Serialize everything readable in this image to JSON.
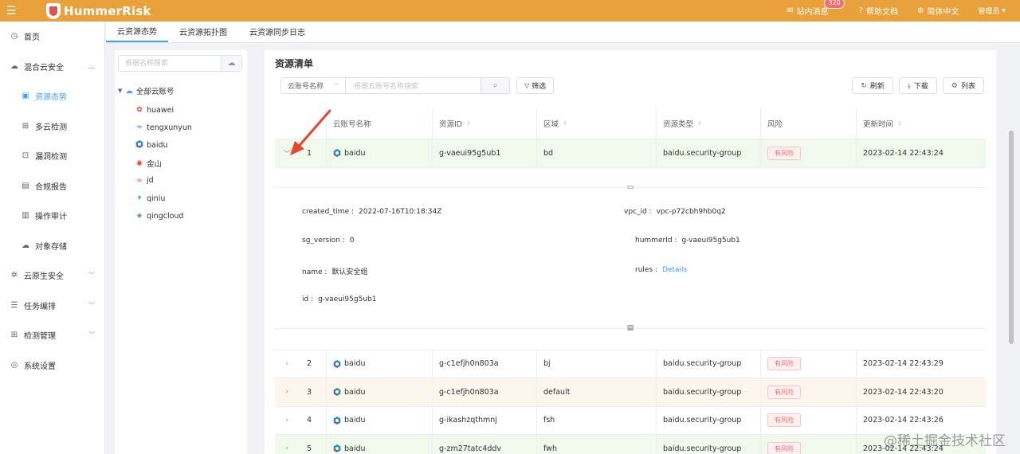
{
  "header": {
    "app_name": "HummerRisk",
    "messages_label": "站内消息",
    "messages_badge": "320",
    "help_label": "帮助文档",
    "language_label": "简体中文",
    "user_label": "管理员"
  },
  "sidebar": {
    "items": [
      {
        "label": "首页",
        "icon": "clock-icon"
      },
      {
        "label": "混合云安全",
        "icon": "cloud-icon"
      },
      {
        "label": "资源态势",
        "icon": "chart-icon"
      },
      {
        "label": "多云检测",
        "icon": "grid-icon"
      },
      {
        "label": "漏洞检测",
        "icon": "bug-icon"
      },
      {
        "label": "合规报告",
        "icon": "report-icon"
      },
      {
        "label": "操作审计",
        "icon": "audit-icon"
      },
      {
        "label": "对象存储",
        "icon": "storage-icon"
      },
      {
        "label": "云原生安全",
        "icon": "gear-icon"
      },
      {
        "label": "任务编排",
        "icon": "list-icon"
      },
      {
        "label": "检测管理",
        "icon": "manage-icon"
      },
      {
        "label": "系统设置",
        "icon": "settings-icon"
      }
    ]
  },
  "tabs": [
    "云资源态势",
    "云资源拓扑图",
    "云资源同步日志"
  ],
  "tree": {
    "search_placeholder": "根据名称搜索",
    "root_label": "全部云账号",
    "nodes": [
      "huawei",
      "tengxunyun",
      "baidu",
      "金山",
      "jd",
      "qiniu",
      "qingcloud"
    ]
  },
  "main": {
    "title": "资源清单",
    "select_label": "云账号名称",
    "search_placeholder": "根据云账号名称搜索",
    "filter_label": "筛选",
    "refresh_label": "刷新",
    "download_label": "下载",
    "columns_label": "列表",
    "headers": [
      "云账号名称",
      "资源ID",
      "区域",
      "资源类型",
      "风险",
      "更新时间"
    ],
    "rows": [
      {
        "idx": "1",
        "account": "baidu",
        "id": "g-vaeui95g5ub1",
        "region": "bd",
        "type": "baidu.security-group",
        "risk": "有风险",
        "time": "2023-02-14 22:43:24"
      },
      {
        "idx": "2",
        "account": "baidu",
        "id": "g-c1efjh0n803a",
        "region": "bj",
        "type": "baidu.security-group",
        "risk": "有风险",
        "time": "2023-02-14 22:43:29"
      },
      {
        "idx": "3",
        "account": "baidu",
        "id": "g-c1efjh0n803a",
        "region": "default",
        "type": "baidu.security-group",
        "risk": "有风险",
        "time": "2023-02-14 22:43:20"
      },
      {
        "idx": "4",
        "account": "baidu",
        "id": "g-ikashzqthmnj",
        "region": "fsh",
        "type": "baidu.security-group",
        "risk": "有风险",
        "time": "2023-02-14 22:43:26"
      },
      {
        "idx": "5",
        "account": "baidu",
        "id": "g-zm27tatc4ddv",
        "region": "fwh",
        "type": "baidu.security-group",
        "risk": "有风险",
        "time": "2023-02-14 22:43:24"
      }
    ],
    "detail": {
      "created_time_key": "created_time :",
      "created_time_val": "2022-07-16T10:18:34Z",
      "vpc_id_key": "vpc_id :",
      "vpc_id_val": "vpc-p72cbh9hb0q2",
      "sg_version_key": "sg_version :",
      "sg_version_val": "0",
      "hummerid_key": "hummerId :",
      "hummerid_val": "g-vaeui95g5ub1",
      "name_key": "name :",
      "name_val": "默认安全组",
      "rules_key": "rules :",
      "rules_val": "Details",
      "id_key": "id :",
      "id_val": "g-vaeui95g5ub1"
    }
  },
  "watermark": "@稀土掘金技术社区",
  "colors": {
    "header": "#e9a23b",
    "accent": "#409eff",
    "danger": "#f56c6c"
  }
}
